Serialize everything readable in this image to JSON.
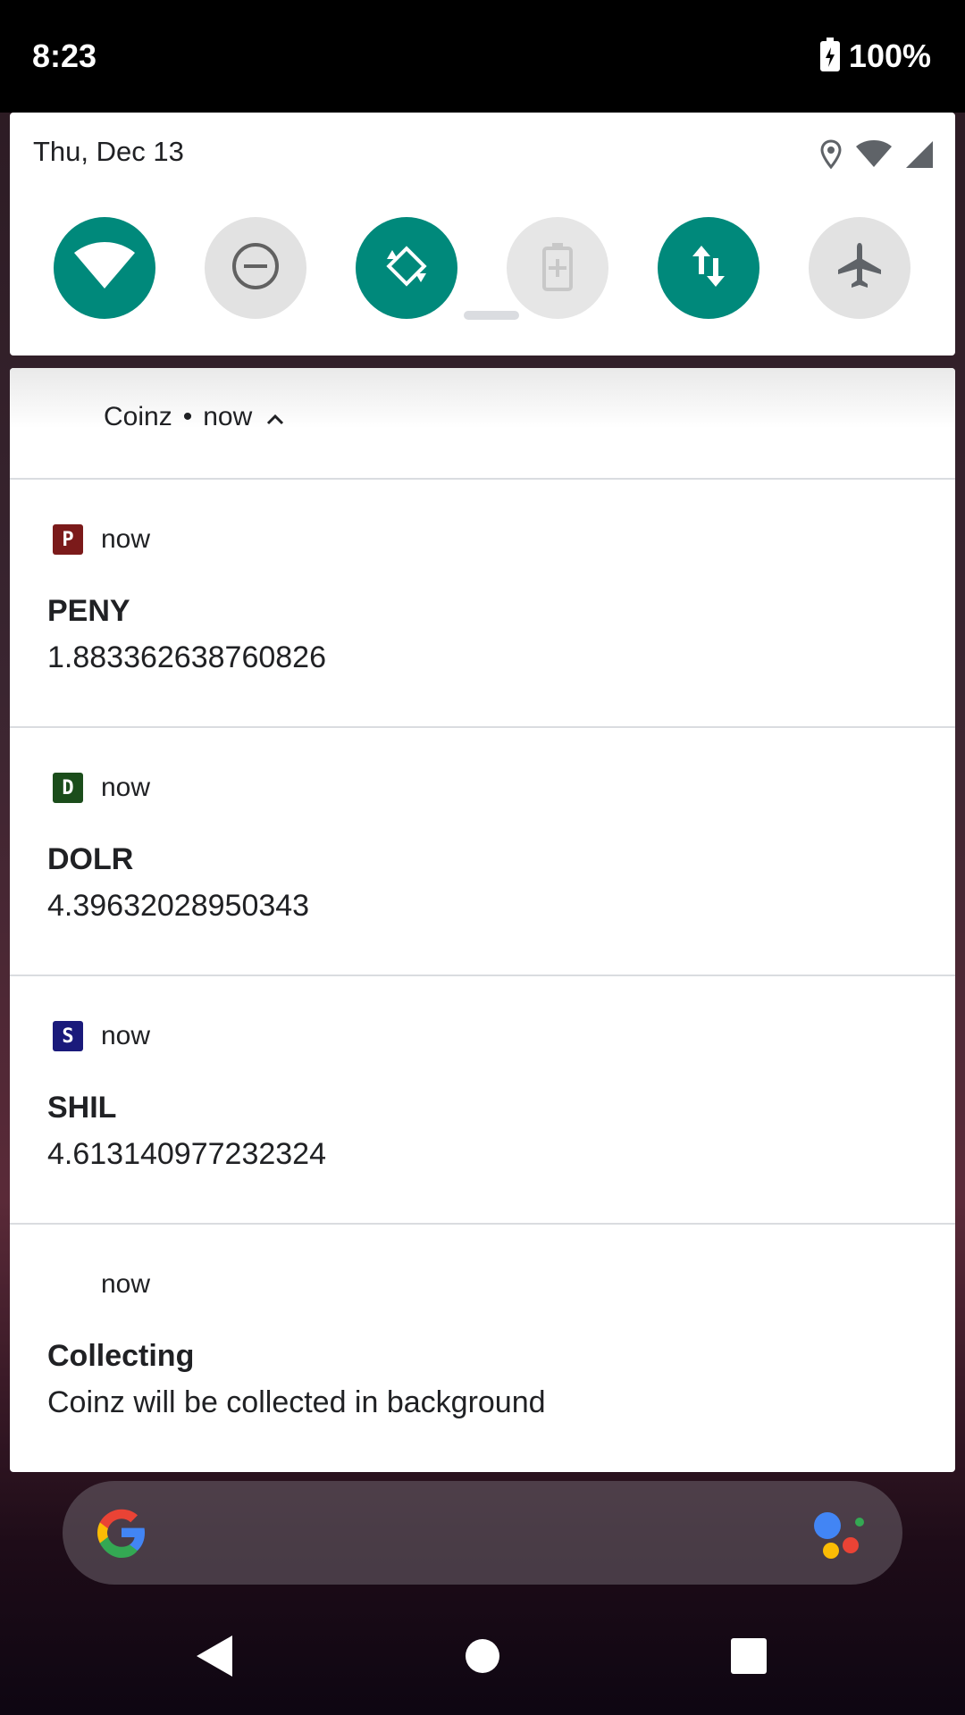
{
  "status_bar": {
    "time": "8:23",
    "battery": "100%"
  },
  "quick_settings": {
    "date": "Thu, Dec 13",
    "tiles": [
      {
        "name": "wifi",
        "state": "on"
      },
      {
        "name": "do-not-disturb",
        "state": "off"
      },
      {
        "name": "auto-rotate",
        "state": "on"
      },
      {
        "name": "battery-saver",
        "state": "disabled"
      },
      {
        "name": "mobile-data",
        "state": "on"
      },
      {
        "name": "airplane-mode",
        "state": "off"
      }
    ],
    "accent_color": "#00897b"
  },
  "notifications": {
    "group": {
      "app_name": "Coinz",
      "separator": "•",
      "time": "now"
    },
    "items": [
      {
        "icon_letter": "P",
        "icon_color": "#7b1a1a",
        "time": "now",
        "title": "PENY",
        "body": "1.883362638760826"
      },
      {
        "icon_letter": "D",
        "icon_color": "#1b4d1b",
        "time": "now",
        "title": "DOLR",
        "body": "4.39632028950343"
      },
      {
        "icon_letter": "S",
        "icon_color": "#1a1a7b",
        "time": "now",
        "title": "SHIL",
        "body": "4.613140977232324"
      },
      {
        "icon_letter": "",
        "icon_color": "",
        "time": "now",
        "title": "Collecting",
        "body": "Coinz will be collected in background"
      }
    ]
  },
  "search_bar": {
    "logo": "google-g-icon",
    "assistant": "google-assistant-icon"
  },
  "nav_bar": {
    "buttons": [
      "back",
      "home",
      "recents"
    ]
  }
}
